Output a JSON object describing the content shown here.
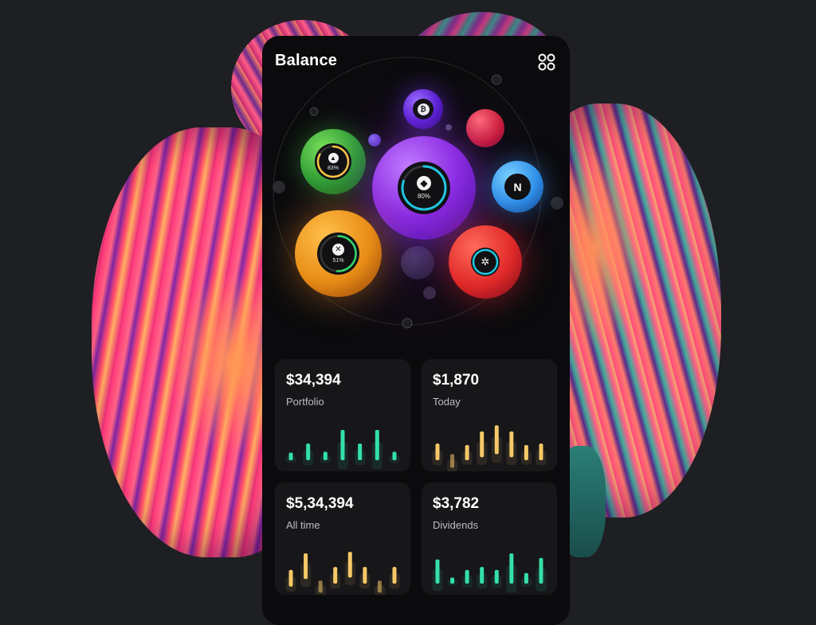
{
  "header": {
    "title": "Balance",
    "menu_icon": "grid-icon"
  },
  "bubbles": [
    {
      "id": "eth",
      "coin_icon": "ethereum-icon",
      "percent_label": "80%",
      "percent": 80,
      "color": "#8a2be2",
      "ring_color": "#21c6e0"
    },
    {
      "id": "aave",
      "coin_icon": "triangle-icon",
      "percent_label": "83%",
      "percent": 83,
      "color": "#3aa33a",
      "ring_color": "#f5c542"
    },
    {
      "id": "stellar",
      "coin_icon": "stellar-icon",
      "percent_label": "51%",
      "percent": 51,
      "color": "#e88c16",
      "ring_color": "#35d36b"
    },
    {
      "id": "near",
      "coin_icon": "near-icon",
      "color": "#3a8fe8"
    },
    {
      "id": "btc",
      "coin_icon": "bitcoin-icon",
      "color": "#6a2ad0"
    },
    {
      "id": "cardano",
      "coin_icon": "cardano-icon",
      "color": "#e02929",
      "ring_color": "#21c6e0"
    }
  ],
  "cards": [
    {
      "amount": "$34,394",
      "label": "Portfolio",
      "bar_color": "#34e0a8",
      "bars": [
        0.25,
        0.55,
        0.28,
        1.0,
        0.55,
        1.0,
        0.28
      ]
    },
    {
      "amount": "$1,870",
      "label": "Today",
      "bar_color": "#f5c867",
      "bars": [
        0.55,
        0.45,
        0.5,
        0.85,
        0.95,
        0.85,
        0.5,
        0.55
      ],
      "bar_offsets": [
        0,
        0.25,
        0,
        -0.1,
        -0.2,
        -0.1,
        0,
        0
      ]
    },
    {
      "amount": "$5,34,394",
      "label": "All time",
      "bar_color": "#f5c867",
      "bars": [
        0.55,
        0.85,
        0.4,
        0.55,
        0.85,
        0.55,
        0.4,
        0.55
      ],
      "bar_offsets": [
        0.1,
        -0.15,
        0.3,
        0,
        -0.2,
        0,
        0.3,
        0
      ]
    },
    {
      "amount": "$3,782",
      "label": "Dividends",
      "bar_color": "#34e0a8",
      "bars": [
        0.8,
        0.2,
        0.45,
        0.55,
        0.45,
        1.0,
        0.35,
        0.85
      ]
    }
  ]
}
